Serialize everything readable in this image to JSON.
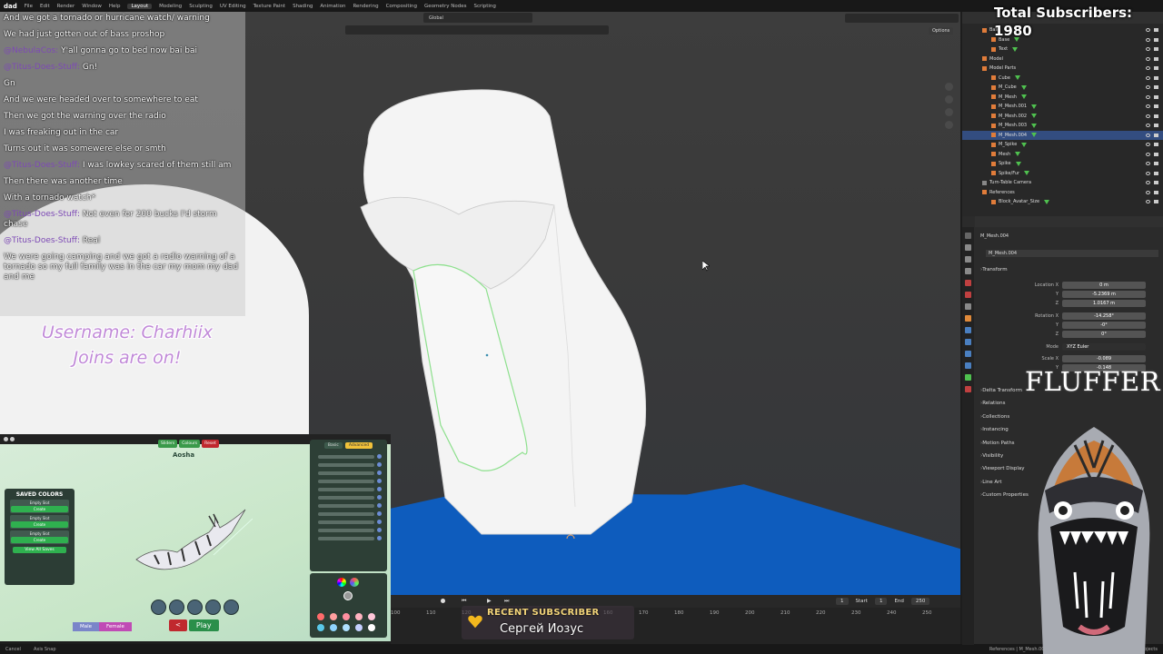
{
  "topbar": {
    "logo": "dad",
    "menus": [
      "File",
      "Edit",
      "Render",
      "Window",
      "Help"
    ],
    "workspaces": [
      "Layout",
      "Modeling",
      "Sculpting",
      "UV Editing",
      "Texture Paint",
      "Shading",
      "Animation",
      "Rendering",
      "Compositing",
      "Geometry Nodes",
      "Scripting"
    ],
    "active_workspace": "Layout"
  },
  "viewport": {
    "orientation": "Global",
    "options_label": "Options"
  },
  "chat": [
    {
      "user": "",
      "msg": "And we got a tornado or hurricane watch/ warning"
    },
    {
      "user": "",
      "msg": "We had just gotten out of bass proshop"
    },
    {
      "user": "@NebulaCos:",
      "msg": "Y'all gonna go to bed now bai bai"
    },
    {
      "user": "@Titus-Does-Stuff:",
      "msg": "Gn!"
    },
    {
      "user": "",
      "msg": "Gn"
    },
    {
      "user": "",
      "msg": "And we were headed over to somewhere to eat"
    },
    {
      "user": "",
      "msg": "Then we got the warning over the radio"
    },
    {
      "user": "",
      "msg": "I was freaking out in the car"
    },
    {
      "user": "",
      "msg": "Turns out it was somewere else or smth"
    },
    {
      "user": "@Titus-Does-Stuff:",
      "msg": "I was lowkey scared of them still am"
    },
    {
      "user": "",
      "msg": "Then there was another time"
    },
    {
      "user": "",
      "msg": "With a tornado watch*"
    },
    {
      "user": "@Titus-Does-Stuff:",
      "msg": "Not even for 200 bucks I'd storm chase"
    },
    {
      "user": "@Titus-Does-Stuff:",
      "msg": "Real"
    },
    {
      "user": "",
      "msg": "We were going camping and we got a radio warning of a tornado so my full family was in the car my mom my dad and me"
    }
  ],
  "stream_info": {
    "line1": "Username: Charhiix",
    "line2": "Joins are on!"
  },
  "game": {
    "saved_colors_title": "SAVED COLORS",
    "slots": [
      {
        "name": "Empty Slot",
        "action": "Create"
      },
      {
        "name": "Empty Slot",
        "action": "Create"
      },
      {
        "name": "Empty Slot",
        "action": "Create"
      }
    ],
    "view_all": "View All Saves",
    "tabs": [
      {
        "label": "Sliders",
        "color": "#3a9a4a"
      },
      {
        "label": "Colours",
        "color": "#3a9a4a"
      },
      {
        "label": "Reset",
        "color": "#c0282e"
      }
    ],
    "creature_name": "Aosha",
    "slider_tabs": [
      {
        "label": "Basic",
        "color": "#3d5a4c",
        "text": "#ddd"
      },
      {
        "label": "Advanced",
        "color": "#f1c23a",
        "text": "#333"
      }
    ],
    "slider_count": 11,
    "gender": [
      {
        "label": "Male",
        "color": "#7a85c9"
      },
      {
        "label": "Female",
        "color": "#c04bb5"
      }
    ],
    "back": "<",
    "play": "Play",
    "swatches": [
      "#ff6b6b",
      "#ff9f9f",
      "#ff8fa0",
      "#ffb3c0",
      "#ffc7d9",
      "#5ac8e8",
      "#8fd4ff",
      "#b0e0ff",
      "#c4d0ff",
      "#ffffff"
    ]
  },
  "timeline": {
    "current_frame": "1",
    "start_label": "Start",
    "start": "1",
    "end_label": "End",
    "end": "250",
    "ruler": [
      "100",
      "110",
      "120",
      "130",
      "140",
      "150",
      "160",
      "170",
      "180",
      "190",
      "200",
      "210",
      "220",
      "230",
      "240",
      "250"
    ]
  },
  "alert": {
    "heading": "RECENT SUBSCRIBER",
    "name": "Сергей Иозус"
  },
  "statusbar": {
    "left": [
      "Cancel",
      "Axis Snap"
    ],
    "right": "References | M_Mesh.004 | Verts:2,798 | Faces:3,770 | Tris:5,088 | Objects"
  },
  "subscriber_counter": {
    "label": "Total Subscribers:",
    "count": "1980"
  },
  "outliner": {
    "items": [
      {
        "name": "Base",
        "indent": 0,
        "color": "#e07c3a",
        "tri": false
      },
      {
        "name": "Base",
        "indent": 1,
        "color": "#e07c3a",
        "tri": true
      },
      {
        "name": "Text",
        "indent": 1,
        "color": "#e07c3a",
        "tri": true
      },
      {
        "name": "Model",
        "indent": 0,
        "color": "#e07c3a",
        "tri": false
      },
      {
        "name": "Model Parts",
        "indent": 0,
        "color": "#e07c3a",
        "tri": false
      },
      {
        "name": "Cube",
        "indent": 1,
        "color": "#e07c3a",
        "tri": true
      },
      {
        "name": "M_Cube",
        "indent": 1,
        "color": "#e07c3a",
        "tri": true
      },
      {
        "name": "M_Mesh",
        "indent": 1,
        "color": "#e07c3a",
        "tri": true
      },
      {
        "name": "M_Mesh.001",
        "indent": 1,
        "color": "#e07c3a",
        "tri": true
      },
      {
        "name": "M_Mesh.002",
        "indent": 1,
        "color": "#e07c3a",
        "tri": true
      },
      {
        "name": "M_Mesh.003",
        "indent": 1,
        "color": "#e07c3a",
        "tri": true
      },
      {
        "name": "M_Mesh.004",
        "indent": 1,
        "color": "#e07c3a",
        "tri": true,
        "selected": true
      },
      {
        "name": "M_Spike",
        "indent": 1,
        "color": "#e07c3a",
        "tri": true
      },
      {
        "name": "Mesh",
        "indent": 1,
        "color": "#e07c3a",
        "tri": true
      },
      {
        "name": "Spike",
        "indent": 1,
        "color": "#e07c3a",
        "tri": true
      },
      {
        "name": "Spike/Fur",
        "indent": 1,
        "color": "#e07c3a",
        "tri": true
      },
      {
        "name": "Turn-Table Camera",
        "indent": 0,
        "color": "#888888",
        "tri": false
      },
      {
        "name": "References",
        "indent": 0,
        "color": "#e07c3a",
        "tri": false
      },
      {
        "name": "Block_Avatar_Size",
        "indent": 1,
        "color": "#e07c3a",
        "tri": true
      }
    ]
  },
  "properties": {
    "object_name": "M_Mesh.004",
    "object_name2": "M_Mesh.004",
    "transform_label": "Transform",
    "fields": [
      {
        "label": "Location X",
        "value": "0 m"
      },
      {
        "label": "Y",
        "value": "-5.2369 m"
      },
      {
        "label": "Z",
        "value": "1.0167 m"
      },
      {
        "label": "Rotation X",
        "value": "-14.258°"
      },
      {
        "label": "Y",
        "value": "-0°"
      },
      {
        "label": "Z",
        "value": "0°"
      },
      {
        "label": "Mode",
        "value": "XYZ Euler"
      },
      {
        "label": "Scale X",
        "value": "-0.089"
      },
      {
        "label": "Y",
        "value": "-0.148"
      }
    ],
    "panels": [
      "Delta Transform",
      "Relations",
      "Collections",
      "Instancing",
      "Motion Paths",
      "Visibility",
      "Viewport Display",
      "Line Art",
      "Custom Properties"
    ]
  },
  "overlay_title": "FLUFFER"
}
